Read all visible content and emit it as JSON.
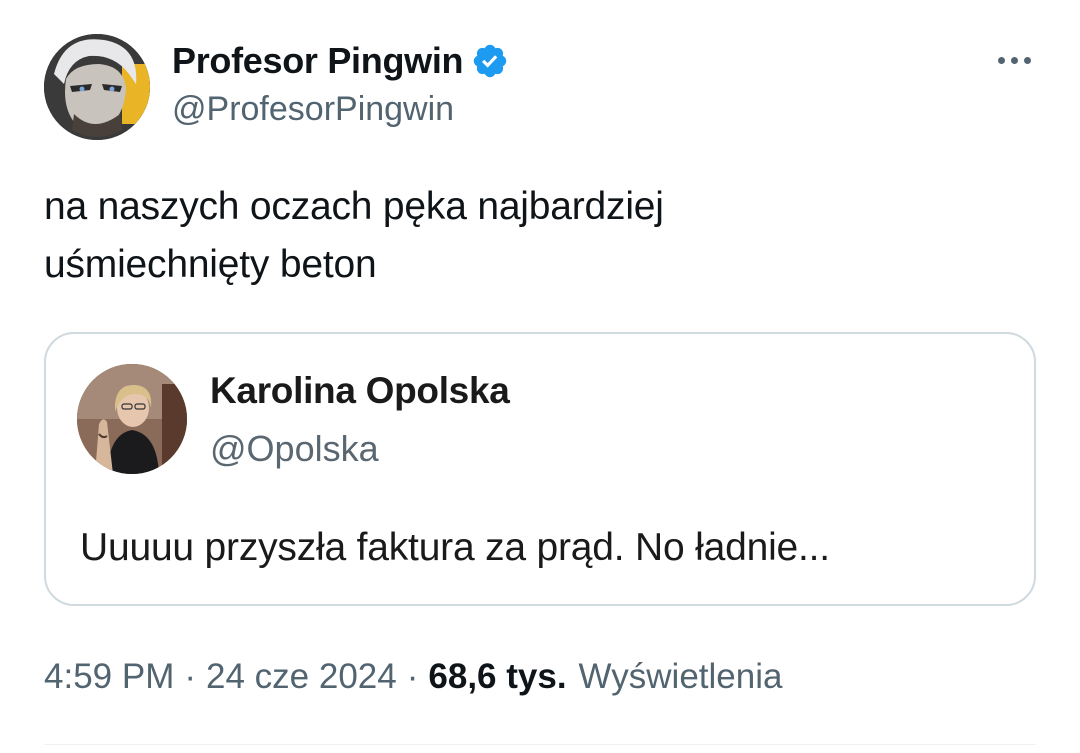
{
  "author": {
    "display_name": "Profesor Pingwin",
    "handle": "@ProfesorPingwin",
    "verified": true,
    "avatar_icon": "anime-character-avatar"
  },
  "more_icon": "more-horizontal-icon",
  "tweet": {
    "text_line1": "na naszych oczach pęka najbardziej",
    "text_line2": "uśmiechnięty beton"
  },
  "quoted": {
    "display_name": "Karolina Opolska",
    "handle": "@Opolska",
    "text": "Uuuuu przyszła faktura za prąd. No ładnie...",
    "avatar_icon": "woman-portrait-avatar"
  },
  "meta": {
    "time": "4:59 PM",
    "separator": "·",
    "date": "24 cze 2024",
    "views_count": "68,6 tys.",
    "views_label": "Wyświetlenia"
  },
  "colors": {
    "verified_blue": "#1d9bf0",
    "text_primary": "#0f1419",
    "text_secondary": "#536471",
    "border": "#cfd9de"
  }
}
